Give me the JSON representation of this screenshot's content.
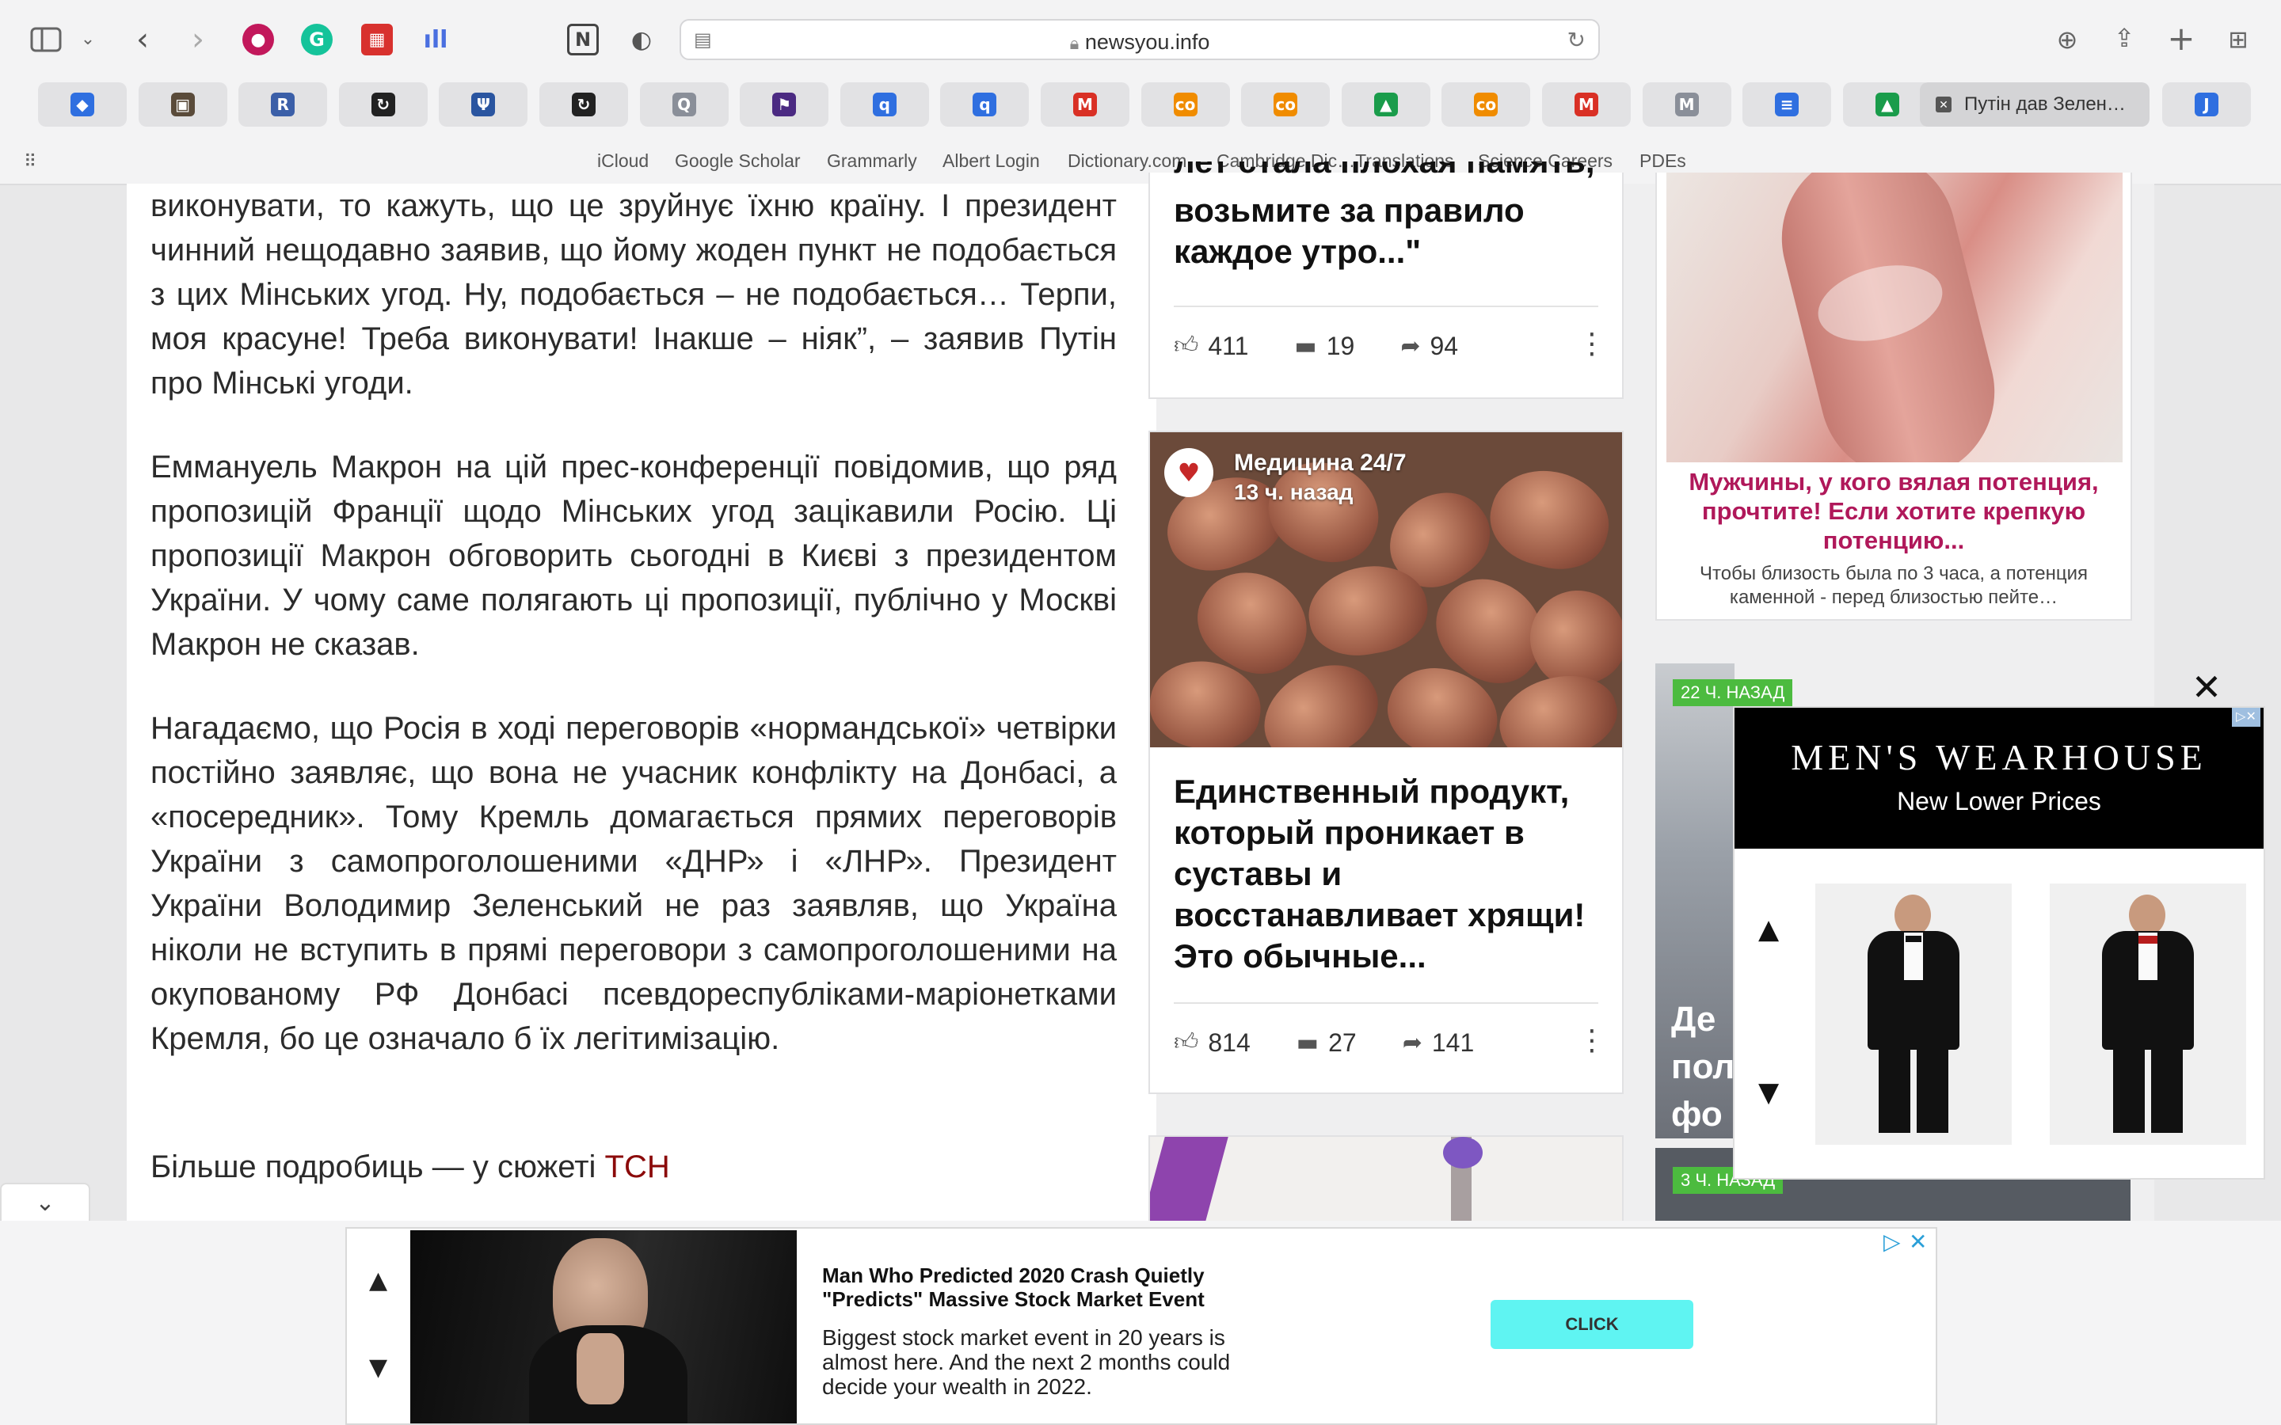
{
  "browser": {
    "url": "newsyou.info",
    "tabs": [
      {
        "icon": "blue-diamond-icon",
        "color": "#2f6fe0",
        "glyph": "◆"
      },
      {
        "icon": "photo-icon",
        "color": "#5a4b3a",
        "glyph": "▣"
      },
      {
        "icon": "r-icon",
        "color": "#3b5fa8",
        "glyph": "R"
      },
      {
        "icon": "loop-icon",
        "color": "#222",
        "glyph": "↻"
      },
      {
        "icon": "psi-icon",
        "color": "#2a55a0",
        "glyph": "Ψ"
      },
      {
        "icon": "loop-icon",
        "color": "#222",
        "glyph": "↻"
      },
      {
        "icon": "q-icon",
        "color": "#8a8f99",
        "glyph": "Q"
      },
      {
        "icon": "bookmark-icon",
        "color": "#4b2a82",
        "glyph": "⚑"
      },
      {
        "icon": "q-blue-icon",
        "color": "#2f6fe0",
        "glyph": "q"
      },
      {
        "icon": "q-blue-icon",
        "color": "#2f6fe0",
        "glyph": "q"
      },
      {
        "icon": "gmail-icon",
        "color": "#d93025",
        "glyph": "M"
      },
      {
        "icon": "co-icon",
        "color": "#f08c00",
        "glyph": "co"
      },
      {
        "icon": "co-icon",
        "color": "#f08c00",
        "glyph": "co"
      },
      {
        "icon": "google-drive-icon",
        "color": "#1a9c4b",
        "glyph": "▲"
      },
      {
        "icon": "co-icon",
        "color": "#f08c00",
        "glyph": "co"
      },
      {
        "icon": "gmail-icon",
        "color": "#d93025",
        "glyph": "M"
      },
      {
        "icon": "m-gray-icon",
        "color": "#8a8f99",
        "glyph": "M"
      },
      {
        "icon": "google-docs-icon",
        "color": "#2f6fe0",
        "glyph": "≡"
      },
      {
        "icon": "google-drive-icon",
        "color": "#1a9c4b",
        "glyph": "▲"
      }
    ],
    "active_tab_label": "Путін дав Зелен…",
    "bookmarks": [
      "iCloud",
      "Google Scholar",
      "Grammarly",
      "Albert Login",
      "Dictionary.com",
      "Cambridge Dic…Translations",
      "Science Careers",
      "PDEs"
    ]
  },
  "article": {
    "p1": "виконувати, то кажуть, що це зруйнує їхню країну. І президент чинний нещодавно заявив, що йому жоден пункт не подобається з цих Мінських угод. Ну, подобається – не подобається… Терпи, моя красуне! Треба виконувати! Інакше – ніяк”, – заявив Путін про Мінські угоди.",
    "p2": "Еммануель Макрон на цій прес-конференції повідомив, що ряд пропозицій Франції щодо Мінських угод зацікавили Росію. Ці пропозиції Макрон обговорить сьогодні в Києві з президентом України. У чому саме полягають ці пропозиції, публічно у Москві Макрон не сказав.",
    "p3": "Нагадаємо, що Росія в ході переговорів «нормандської» четвірки постійно заявляє, що вона не учасник конфлікту на Донбасі, а «посередник». Тому Кремль домагається прямих переговорів України з самопроголошеними «ДНР» і «ЛНР». Президент України Володимир Зеленський не раз заявляв, що Україна ніколи не вступить в прямі переговори з самопроголошеними на окупованому РФ Донбасі псевдореспубліками-маріонетками Кремля, бо це означало б їх легітимізацію.",
    "p4_prefix": "Більше подробиць — у сюжеті ",
    "p4_link": "ТСН"
  },
  "cards": {
    "card1": {
      "title_partial": "лет стала плохая память,",
      "title": "возьмите за правило каждое утро...\"",
      "likes": "411",
      "comments": "19",
      "shares": "94"
    },
    "card2": {
      "source": "Медицина 24/7",
      "time": "13 ч. назад",
      "title": "Единственный продукт, который проникает в суставы и восстанавливает хрящи! Это обычные...",
      "likes": "814",
      "comments": "27",
      "shares": "141"
    }
  },
  "side_ads": {
    "potency_title": "Мужчины, у кого вялая потенция, прочтите! Если хотите крепкую потенцию...",
    "potency_text": "Чтобы близость была по 3 часа, а потенция каменной - перед близостью пейте…",
    "tag1": "22 Ч. НАЗАД",
    "tag2": "3 Ч. НАЗАД",
    "partial_text": [
      "Де",
      "пол",
      "фо"
    ]
  },
  "mens_ad": {
    "brand": "MEN'S WEARHOUSE",
    "tagline": "New Lower Prices"
  },
  "bottom_ad": {
    "headline": "Man Who Predicted 2020 Crash Quietly \"Predicts\" Massive Stock Market Event",
    "body": "Biggest stock market event in 20 years is almost here. And the next 2 months could decide your wealth in 2022.",
    "cta": "CLICK"
  }
}
